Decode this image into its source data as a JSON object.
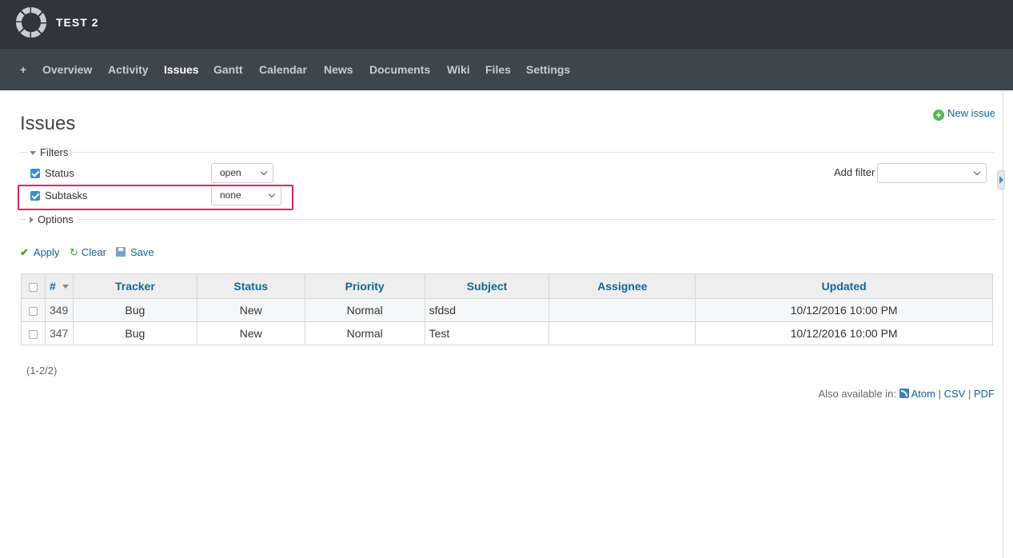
{
  "header": {
    "project_title": "TEST 2"
  },
  "menu": {
    "items": [
      {
        "label": "+"
      },
      {
        "label": "Overview"
      },
      {
        "label": "Activity"
      },
      {
        "label": "Issues"
      },
      {
        "label": "Gantt"
      },
      {
        "label": "Calendar"
      },
      {
        "label": "News"
      },
      {
        "label": "Documents"
      },
      {
        "label": "Wiki"
      },
      {
        "label": "Files"
      },
      {
        "label": "Settings"
      }
    ],
    "selected": "Issues"
  },
  "page": {
    "title": "Issues",
    "new_issue_label": "New issue"
  },
  "filters": {
    "legend": "Filters",
    "rows": [
      {
        "label": "Status",
        "checked": true,
        "value": "open"
      },
      {
        "label": "Subtasks",
        "checked": true,
        "value": "none"
      }
    ],
    "add_filter_label": "Add filter",
    "add_filter_value": ""
  },
  "options": {
    "legend": "Options"
  },
  "actions": {
    "apply": "Apply",
    "clear": "Clear",
    "save": "Save"
  },
  "table": {
    "columns": [
      "#",
      "Tracker",
      "Status",
      "Priority",
      "Subject",
      "Assignee",
      "Updated"
    ],
    "rows": [
      {
        "id": "349",
        "tracker": "Bug",
        "status": "New",
        "priority": "Normal",
        "subject": "sfdsd",
        "assignee": "",
        "updated": "10/12/2016 10:00 PM"
      },
      {
        "id": "347",
        "tracker": "Bug",
        "status": "New",
        "priority": "Normal",
        "subject": "Test",
        "assignee": "",
        "updated": "10/12/2016 10:00 PM"
      }
    ]
  },
  "pagination": {
    "text": "(1-2/2)"
  },
  "other_formats": {
    "prefix": "Also available in:",
    "atom": "Atom",
    "separator": "|",
    "csv": "CSV",
    "pdf": "PDF"
  },
  "colors": {
    "header_bg": "#2e353b",
    "menu_bg": "#3e464d",
    "link": "#116699",
    "highlight": "#e0206e"
  }
}
